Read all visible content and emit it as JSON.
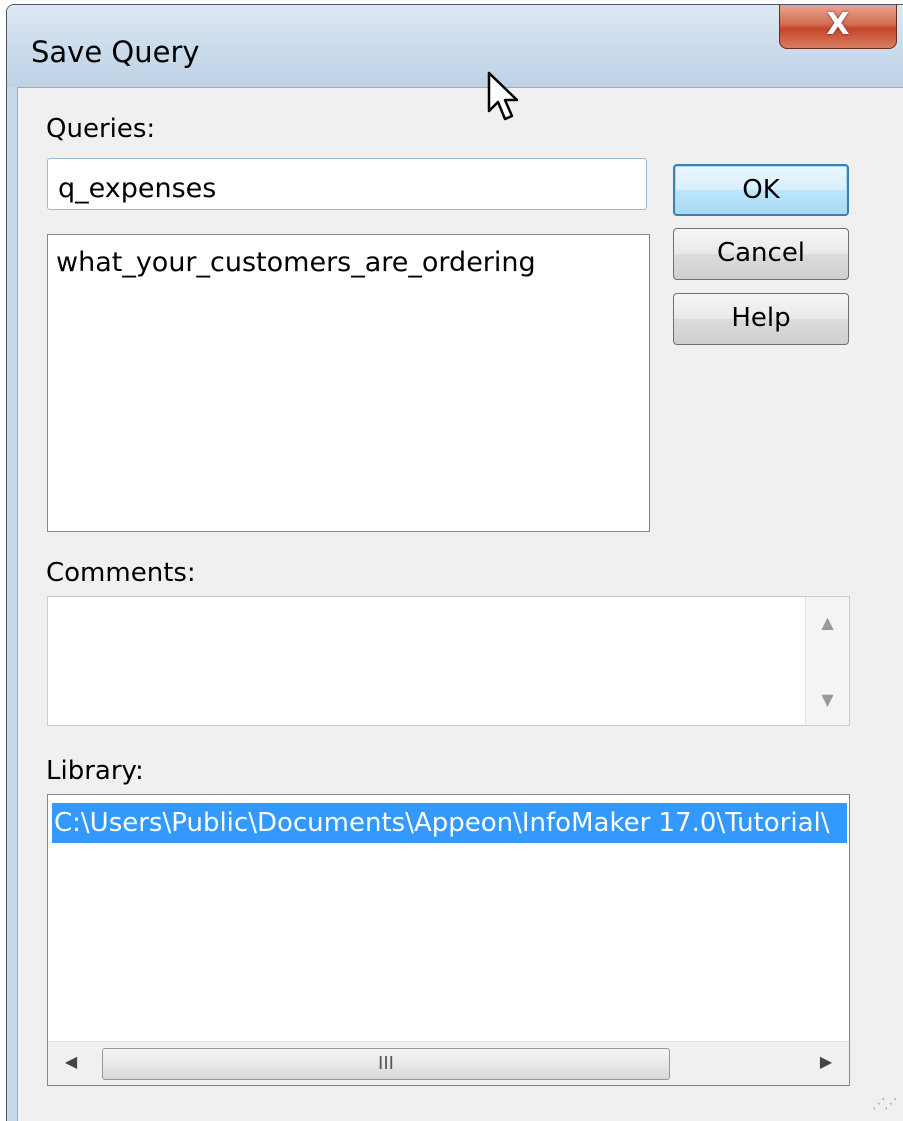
{
  "window": {
    "title": "Save Query",
    "close_label": "X"
  },
  "queries": {
    "label": "Queries:",
    "input_value": "q_expenses",
    "items": [
      "what_your_customers_are_ordering"
    ]
  },
  "buttons": {
    "ok": "OK",
    "cancel": "Cancel",
    "help": "Help"
  },
  "comments": {
    "label": "Comments:",
    "value": ""
  },
  "library": {
    "label": "Library:",
    "selected": "C:\\Users\\Public\\Documents\\Appeon\\InfoMaker 17.0\\Tutorial\\"
  },
  "scrollbar": {
    "thumb_grip": "III"
  },
  "icons": {
    "close": "close-icon",
    "up": "scroll-up-arrow-icon",
    "down": "scroll-down-arrow-icon",
    "left": "scroll-left-arrow-icon",
    "right": "scroll-right-arrow-icon",
    "grip": "resize-grip-icon",
    "cursor": "mouse-pointer-icon"
  }
}
